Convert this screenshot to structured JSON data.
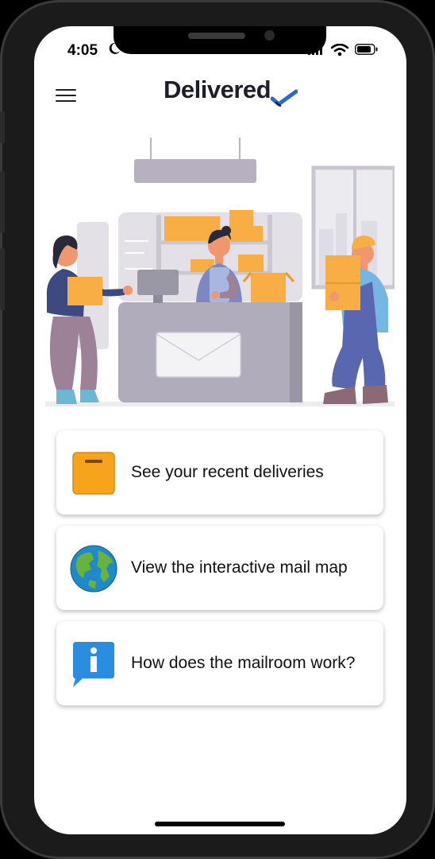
{
  "status_bar": {
    "time": "4:05"
  },
  "header": {
    "app_title": "Delivered"
  },
  "colors": {
    "accent_blue": "#2f68c8",
    "package_orange": "#f7a41d",
    "info_blue": "#2b8de0"
  },
  "cards": [
    {
      "label": "See your recent deliveries",
      "icon": "package-icon"
    },
    {
      "label": "View the interactive mail map",
      "icon": "globe-icon"
    },
    {
      "label": "How does the mailroom work?",
      "icon": "info-icon"
    }
  ]
}
